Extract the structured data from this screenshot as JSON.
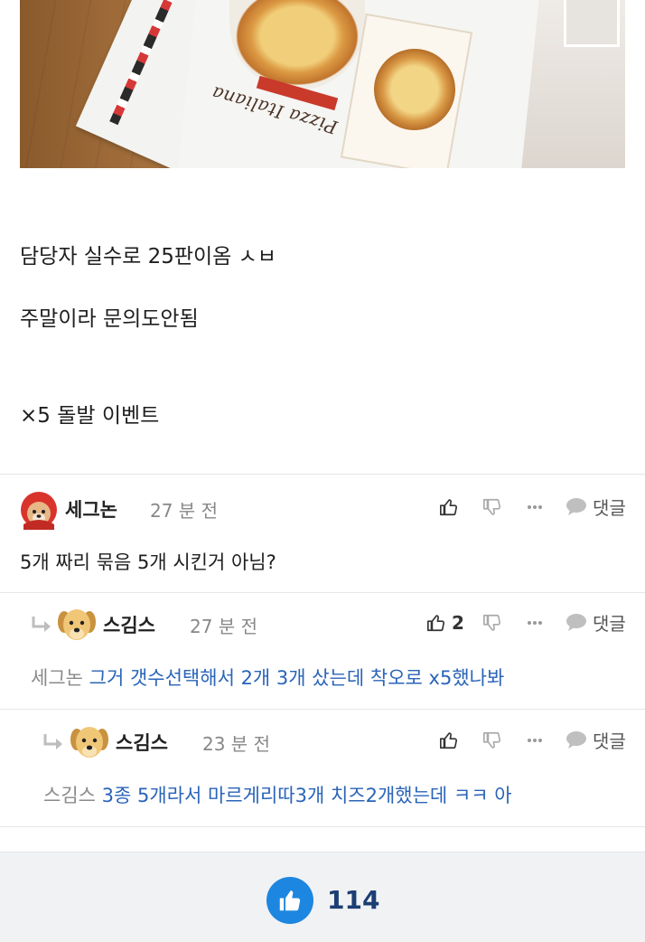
{
  "post": {
    "lines": [
      "담당자 실수로 25판이옴 ㅅㅂ",
      "주말이라 문의도안됨",
      "×5 돌발 이벤트"
    ],
    "photo_brand": "Pizza Italiana"
  },
  "comments": [
    {
      "author": "세그논",
      "time": "27 분 전",
      "like_count": "",
      "reply_label": "댓글",
      "text": "5개 짜리 묶음 5개 시킨거 아님?",
      "mention": "",
      "avatar": "red-hood-dog-avatar"
    },
    {
      "author": "스김스",
      "time": "27 분 전",
      "like_count": "2",
      "reply_label": "댓글",
      "mention": "세그논",
      "text": "그거 갯수선택해서 2개 3개 샀는데 착오로 x5했나봐",
      "avatar": "puppy-avatar"
    },
    {
      "author": "스김스",
      "time": "23 분 전",
      "like_count": "",
      "reply_label": "댓글",
      "mention": "스김스",
      "text": "3종 5개라서 마르게리따3개 치즈2개했는데 ㅋㅋ 아",
      "avatar": "puppy-avatar"
    }
  ],
  "bottom": {
    "like_total": "114"
  },
  "colors": {
    "accent_blue": "#1d86e0",
    "reply_text": "#2a64b8",
    "muted": "#888888"
  },
  "icons": [
    "thumbs-up-icon",
    "thumbs-down-icon",
    "more-icon",
    "comment-bubble-icon",
    "reply-arrow-icon"
  ]
}
